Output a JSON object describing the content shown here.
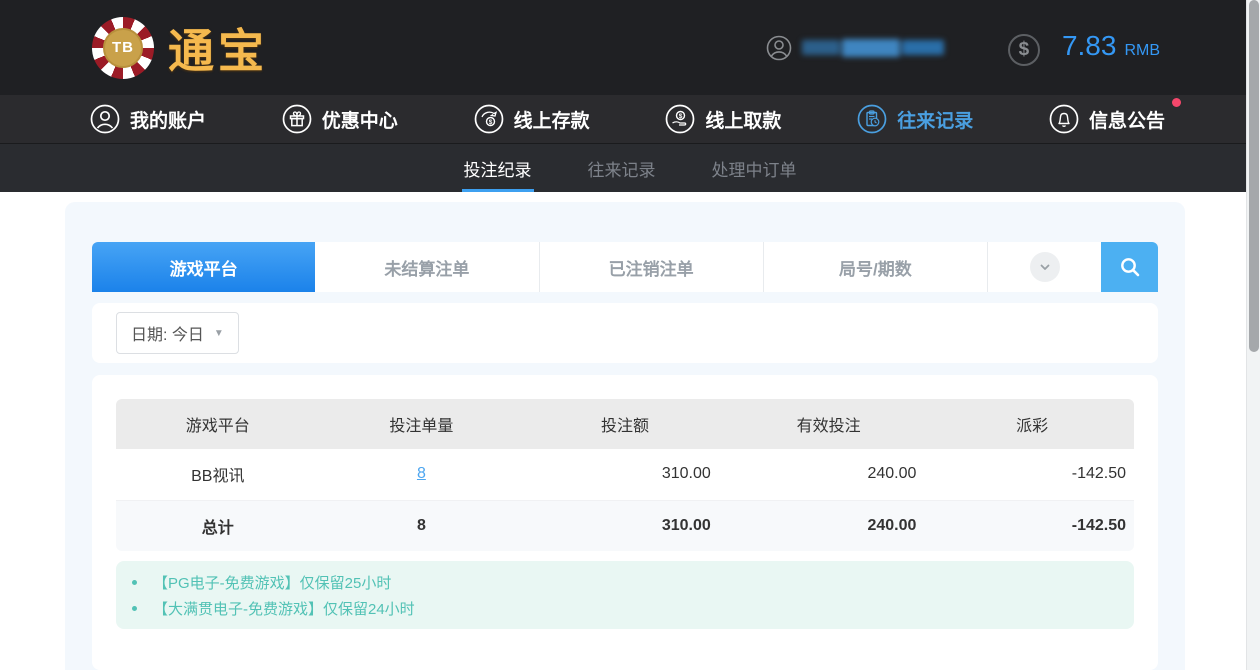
{
  "header": {
    "logo_badge": "TB",
    "logo_text": "通宝",
    "balance": "7.83",
    "currency": "RMB"
  },
  "nav": {
    "items": [
      {
        "label": "我的账户",
        "icon": "user-icon",
        "active": false
      },
      {
        "label": "优惠中心",
        "icon": "gift-icon",
        "active": false
      },
      {
        "label": "线上存款",
        "icon": "deposit-icon",
        "active": false
      },
      {
        "label": "线上取款",
        "icon": "withdraw-icon",
        "active": false
      },
      {
        "label": "往来记录",
        "icon": "records-icon",
        "active": true
      },
      {
        "label": "信息公告",
        "icon": "bell-icon",
        "active": false,
        "notification_dot": true
      }
    ]
  },
  "subnav": {
    "items": [
      {
        "label": "投注纪录",
        "active": true
      },
      {
        "label": "往来记录",
        "active": false
      },
      {
        "label": "处理中订单",
        "active": false
      }
    ]
  },
  "tabs": {
    "items": [
      {
        "label": "游戏平台",
        "active": true
      },
      {
        "label": "未结算注单",
        "active": false
      },
      {
        "label": "已注销注单",
        "active": false
      },
      {
        "label": "局号/期数",
        "active": false
      }
    ],
    "dropdown_icon": "chevron-down-icon",
    "search_icon": "search-icon"
  },
  "filters": {
    "date_label": "日期: 今日"
  },
  "table": {
    "columns": [
      "游戏平台",
      "投注单量",
      "投注额",
      "有效投注",
      "派彩"
    ],
    "rows": [
      {
        "platform": "BB视讯",
        "count": "8",
        "amount": "310.00",
        "valid": "240.00",
        "payout": "-142.50"
      }
    ],
    "total": {
      "label": "总计",
      "count": "8",
      "amount": "310.00",
      "valid": "240.00",
      "payout": "-142.50"
    }
  },
  "notes": {
    "items": [
      "【PG电子-免费游戏】仅保留25小时",
      "【大满贯电子-免费游戏】仅保留24小时"
    ]
  },
  "colors": {
    "accent_blue": "#3d9ff0",
    "nav_active_blue": "#4a9fe0",
    "tab_gradient_top": "#47a4f5",
    "tab_gradient_bottom": "#1b82ea",
    "search_button_blue": "#4cb0f2",
    "balance_blue": "#3498f5",
    "link_blue": "#4da6f0",
    "negative_red": "#f4516c",
    "notification_red": "#f5476b",
    "note_teal": "#52c2b5",
    "note_bg": "#e9f7f3",
    "panel_bg": "#f3f8fd"
  }
}
